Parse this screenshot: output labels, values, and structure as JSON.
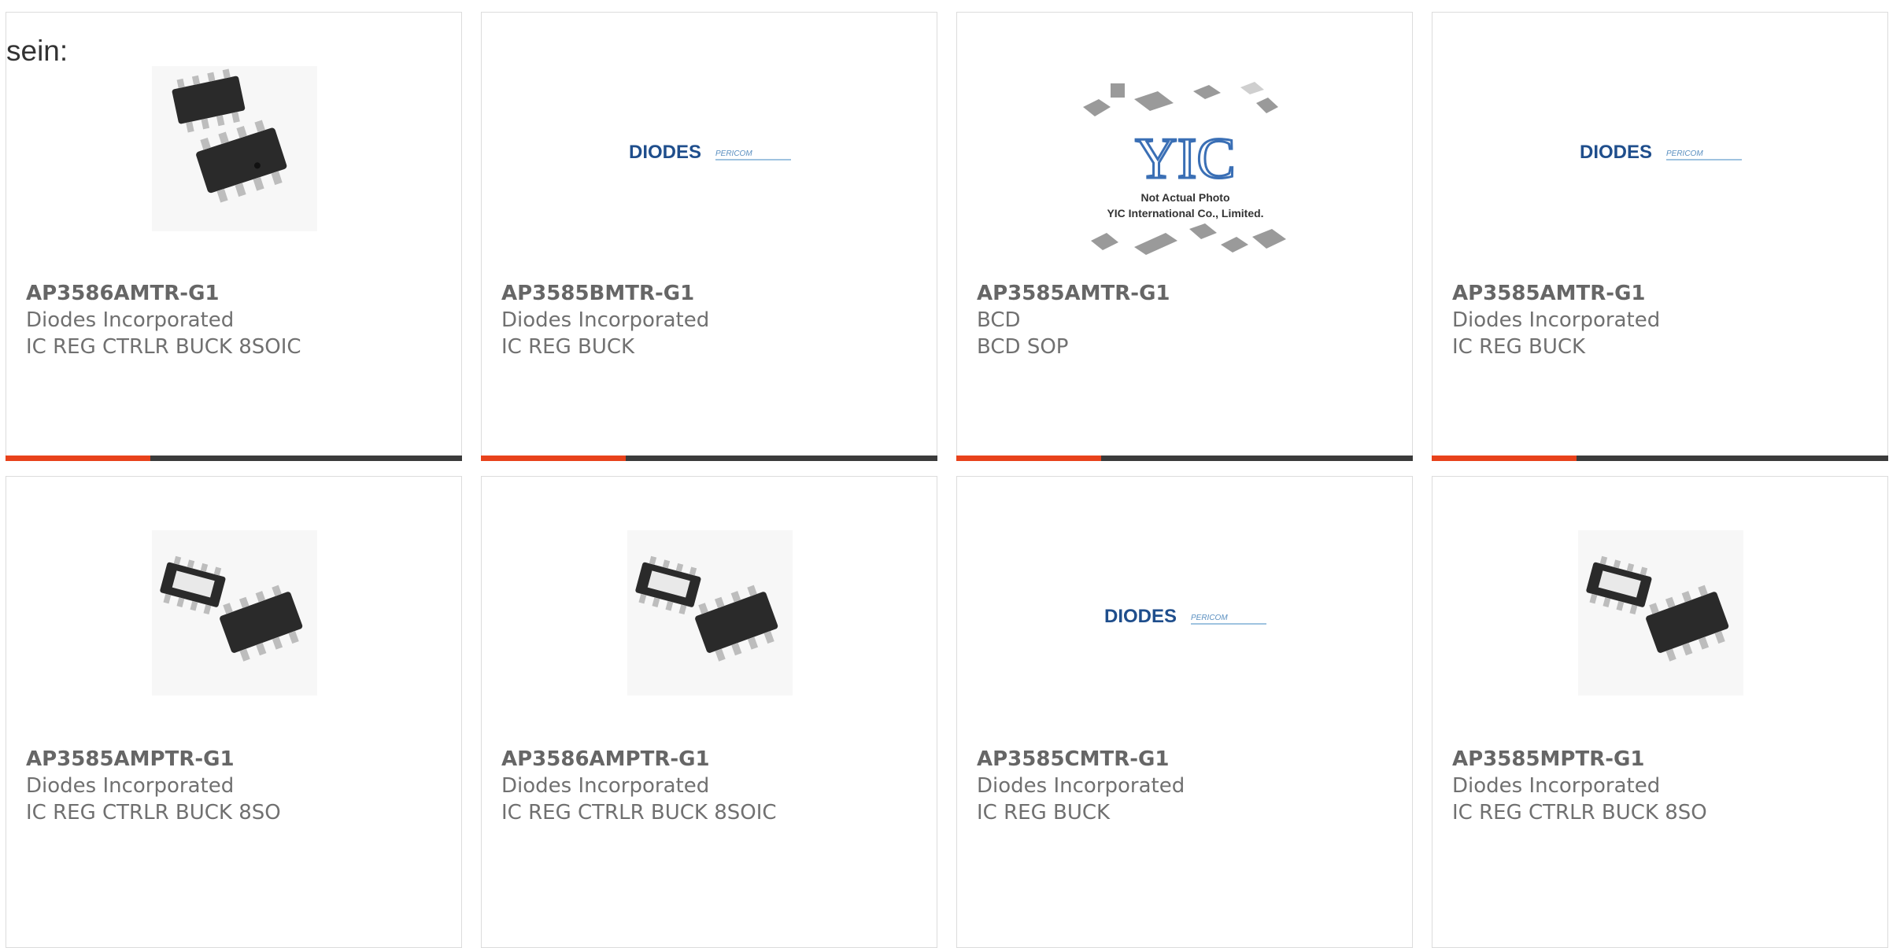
{
  "lead_text": "sein:",
  "colors": {
    "accent": "#e8421b",
    "bar": "#3b3b3b",
    "border": "#dcdcdc",
    "text": "#666666"
  },
  "products": [
    {
      "part": "AP3586AMTR-G1",
      "manufacturer": "Diodes Incorporated",
      "description": "IC REG CTRLR BUCK 8SOIC",
      "image": "soic-8-chip-photo"
    },
    {
      "part": "AP3585BMTR-G1",
      "manufacturer": "Diodes Incorporated",
      "description": "IC REG BUCK",
      "image": "diodes-pericom-logo",
      "logo_text": "DIODES",
      "logo_sub": "PERICOM"
    },
    {
      "part": "AP3585AMTR-G1",
      "manufacturer": "BCD",
      "description": "BCD SOP",
      "image": "yic-placeholder",
      "logo_text": "YIC",
      "logo_line1": "Not Actual Photo",
      "logo_line2": "YIC International Co., Limited."
    },
    {
      "part": "AP3585AMTR-G1",
      "manufacturer": "Diodes Incorporated",
      "description": "IC REG BUCK",
      "image": "diodes-pericom-logo",
      "logo_text": "DIODES",
      "logo_sub": "PERICOM"
    },
    {
      "part": "AP3585AMPTR-G1",
      "manufacturer": "Diodes Incorporated",
      "description": "IC REG CTRLR BUCK 8SO",
      "image": "soic-8-chip-photo"
    },
    {
      "part": "AP3586AMPTR-G1",
      "manufacturer": "Diodes Incorporated",
      "description": "IC REG CTRLR BUCK 8SOIC",
      "image": "soic-8-chip-photo"
    },
    {
      "part": "AP3585CMTR-G1",
      "manufacturer": "Diodes Incorporated",
      "description": "IC REG BUCK",
      "image": "diodes-pericom-logo",
      "logo_text": "DIODES",
      "logo_sub": "PERICOM"
    },
    {
      "part": "AP3585MPTR-G1",
      "manufacturer": "Diodes Incorporated",
      "description": "IC REG CTRLR BUCK 8SO",
      "image": "soic-8-chip-photo"
    }
  ]
}
